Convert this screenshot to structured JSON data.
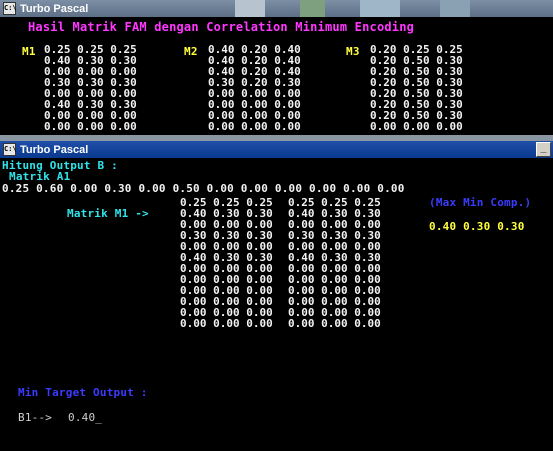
{
  "window1": {
    "title": "Turbo Pascal",
    "heading": "Hasil Matrik FAM dengan Correlation Minimum Encoding",
    "m1_label": "M1",
    "m2_label": "M2",
    "m3_label": "M3",
    "m1_rows": [
      "0.25 0.25 0.25",
      "0.40 0.30 0.30",
      "0.00 0.00 0.00",
      "0.30 0.30 0.30",
      "0.00 0.00 0.00",
      "0.40 0.30 0.30",
      "0.00 0.00 0.00",
      "0.00 0.00 0.00"
    ],
    "m2_rows": [
      "0.40 0.20 0.40",
      "0.40 0.20 0.40",
      "0.40 0.20 0.40",
      "0.30 0.20 0.30",
      "0.00 0.00 0.00",
      "0.00 0.00 0.00",
      "0.00 0.00 0.00",
      "0.00 0.00 0.00"
    ],
    "m3_rows": [
      "0.20 0.25 0.25",
      "0.20 0.50 0.30",
      "0.20 0.50 0.30",
      "0.20 0.50 0.30",
      "0.20 0.50 0.30",
      "0.20 0.50 0.30",
      "0.20 0.50 0.30",
      "0.00 0.00 0.00"
    ]
  },
  "window2": {
    "title": "Turbo Pascal",
    "minimize_symbol": "_",
    "hitung_label": "Hitung Output B :",
    "matrik_a1_label": "Matrik A1",
    "a1_values": "0.25 0.60 0.00 0.30 0.00 0.50 0.00 0.00 0.00 0.00 0.00 0.00",
    "matrik_m1_label": "Matrik M1 ->",
    "m1_left_rows": [
      "0.25 0.25 0.25",
      "0.40 0.30 0.30",
      "0.00 0.00 0.00",
      "0.30 0.30 0.30",
      "0.00 0.00 0.00",
      "0.40 0.30 0.30",
      "0.00 0.00 0.00",
      "0.00 0.00 0.00",
      "0.00 0.00 0.00",
      "0.00 0.00 0.00",
      "0.00 0.00 0.00",
      "0.00 0.00 0.00"
    ],
    "m1_right_rows": [
      "0.25 0.25 0.25",
      "0.40 0.30 0.30",
      "0.00 0.00 0.00",
      "0.30 0.30 0.30",
      "0.00 0.00 0.00",
      "0.40 0.30 0.30",
      "0.00 0.00 0.00",
      "0.00 0.00 0.00",
      "0.00 0.00 0.00",
      "0.00 0.00 0.00",
      "0.00 0.00 0.00",
      "0.00 0.00 0.00"
    ],
    "max_min_label": "(Max Min Comp.)",
    "max_min_values": "0.40 0.30 0.30",
    "min_target_label": "Min Target Output :",
    "b1_prompt": "B1-->",
    "b1_value": "0.40",
    "cursor": "_"
  }
}
